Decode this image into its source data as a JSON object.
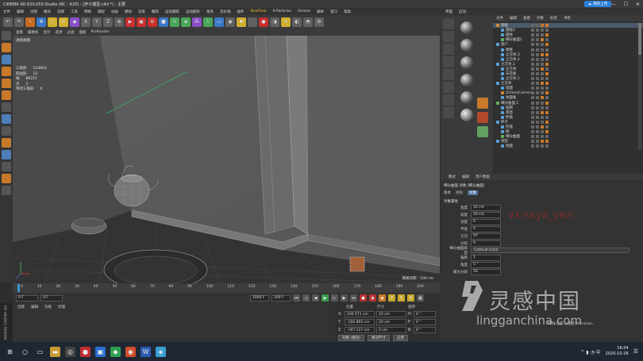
{
  "window": {
    "title": "CINEMA 4D R20.059 Studio (RC - R20) - [杯子模型.c4d *] - 主要",
    "cloud_button": "我的上传"
  },
  "menu": {
    "items": [
      "文件",
      "编辑",
      "创建",
      "模式",
      "选择",
      "工具",
      "网格",
      "捕捉",
      "动画",
      "模拟",
      "渲染",
      "雕刻",
      "运动跟踪",
      "运动图形",
      "角色",
      "流水线",
      "插件",
      "RealFlow",
      "X-Particles",
      "Octane",
      "脚本",
      "窗口",
      "帮助"
    ],
    "highlight": "RealFlow",
    "right_items": [
      "界面",
      "启动"
    ]
  },
  "toolbar": {
    "axis_buttons": [
      "X",
      "Y",
      "Z"
    ]
  },
  "viewport": {
    "menu": [
      "查看",
      "摄像机",
      "显示",
      "选项",
      "过滤",
      "面板",
      "ProRender"
    ],
    "label": "透视视图",
    "stats": [
      {
        "label": "三角形",
        "value": "114843"
      },
      {
        "label": "四边形",
        "value": "12"
      },
      {
        "label": "线",
        "value": "86215"
      },
      {
        "label": "点",
        "value": "1"
      },
      {
        "label": "带状三角形",
        "value": "0"
      }
    ],
    "footer": "网格间距 : 100 cm"
  },
  "timeline": {
    "ticks": [
      "0",
      "10",
      "20",
      "30",
      "40",
      "50",
      "60",
      "70",
      "80",
      "90",
      "100",
      "110",
      "120",
      "130",
      "140",
      "150",
      "160",
      "170",
      "180",
      "190",
      "200"
    ],
    "start_field": "0 F",
    "current_field": "0 F",
    "end_field": "1000 F",
    "end2_field": "100 F"
  },
  "materials": {
    "menu": [
      "创建",
      "编辑",
      "功能",
      "纹理"
    ]
  },
  "coords": {
    "headers": [
      "位置",
      "尺寸",
      "旋转"
    ],
    "rows": [
      {
        "axis": "X",
        "pos": "100.571 cm",
        "size": "10 cm",
        "rot_label": "H",
        "rot": "0 °"
      },
      {
        "axis": "Y",
        "pos": "-100.865 cm",
        "size": "20 cm",
        "rot_label": "P",
        "rot": "0 °"
      },
      {
        "axis": "Z",
        "pos": "-197.117 cm",
        "size": "0 cm",
        "rot_label": "B",
        "rot": "0 °"
      }
    ],
    "mode_button": "对象 (相对)",
    "size_button": "绝对尺寸",
    "apply_button": "应用"
  },
  "object_manager": {
    "menu": [
      "文件",
      "编辑",
      "查看",
      "对象",
      "标签",
      "书签"
    ],
    "rows": [
      {
        "name": "窗框",
        "type": "o",
        "sel": true
      },
      {
        "name": "圆柱2",
        "type": "b",
        "sel": false
      },
      {
        "name": "圆柱",
        "type": "b",
        "sel": false
      },
      {
        "name": "细分曲面1",
        "type": "g",
        "sel": false
      },
      {
        "name": "窗户",
        "type": "b",
        "sel": false
      },
      {
        "name": "窗框",
        "type": "b",
        "sel": false
      },
      {
        "name": "立方体.3",
        "type": "b",
        "sel": false
      },
      {
        "name": "立方体.2",
        "type": "b",
        "sel": false
      },
      {
        "name": "立方体.1",
        "type": "b",
        "sel": false
      },
      {
        "name": "立方体",
        "type": "b",
        "sel": false
      },
      {
        "name": "天花板",
        "type": "b",
        "sel": false
      },
      {
        "name": "立方体.1",
        "type": "b",
        "sel": false
      },
      {
        "name": "立方体",
        "type": "b",
        "sel": false
      },
      {
        "name": "墙面",
        "type": "b",
        "sel": false
      },
      {
        "name": "OctaneCamera",
        "type": "o",
        "sel": false
      },
      {
        "name": "地面板",
        "type": "b",
        "sel": false
      },
      {
        "name": "细分曲面.1",
        "type": "g",
        "sel": false
      },
      {
        "name": "插销",
        "type": "b",
        "sel": false
      },
      {
        "name": "茶壶",
        "type": "b",
        "sel": false
      },
      {
        "name": "杯盘",
        "type": "b",
        "sel": false
      },
      {
        "name": "杯子",
        "type": "b",
        "sel": false
      },
      {
        "name": "托盘",
        "type": "b",
        "sel": false
      },
      {
        "name": "碗",
        "type": "b",
        "sel": false
      },
      {
        "name": "细分曲面",
        "type": "g",
        "sel": false
      },
      {
        "name": "地垫",
        "type": "b",
        "sel": false
      },
      {
        "name": "地面",
        "type": "b",
        "sel": false
      }
    ]
  },
  "attributes": {
    "tabs": [
      "模式",
      "编辑",
      "用户数据"
    ],
    "object_title": "细分曲面 对象 [细分曲面]",
    "sub_tabs": [
      "基本",
      "坐标",
      "对象"
    ],
    "section": "对象属性",
    "fields": [
      {
        "label": "宽度",
        "value": "10 cm"
      },
      {
        "label": "高度",
        "value": "20 cm"
      },
      {
        "label": "深度",
        "value": "0"
      },
      {
        "label": "半径",
        "value": "0"
      },
      {
        "label": "方向",
        "value": "XY"
      },
      {
        "label": "分段",
        "value": "0"
      }
    ],
    "dropdown_label": "细分曲面类型",
    "dropdown_value": "Catmull-Clark",
    "extra": [
      {
        "label": "偏移",
        "value": "1"
      },
      {
        "label": "角度",
        "value": "5 °"
      },
      {
        "label": "最大分段",
        "value": "16"
      }
    ]
  },
  "watermark": {
    "text": "vx:saya_yezi",
    "brand_cn": "灵感中国",
    "brand_en": "lingganchina.com",
    "activation": "转到 设置 以激活 Windows。"
  },
  "taskbar": {
    "time": "16:04",
    "date": "2020-10-26"
  },
  "colors": {
    "accent_blue": "#3c78c8",
    "accent_orange": "#c87a2a",
    "selection": "#4a5a6a"
  }
}
